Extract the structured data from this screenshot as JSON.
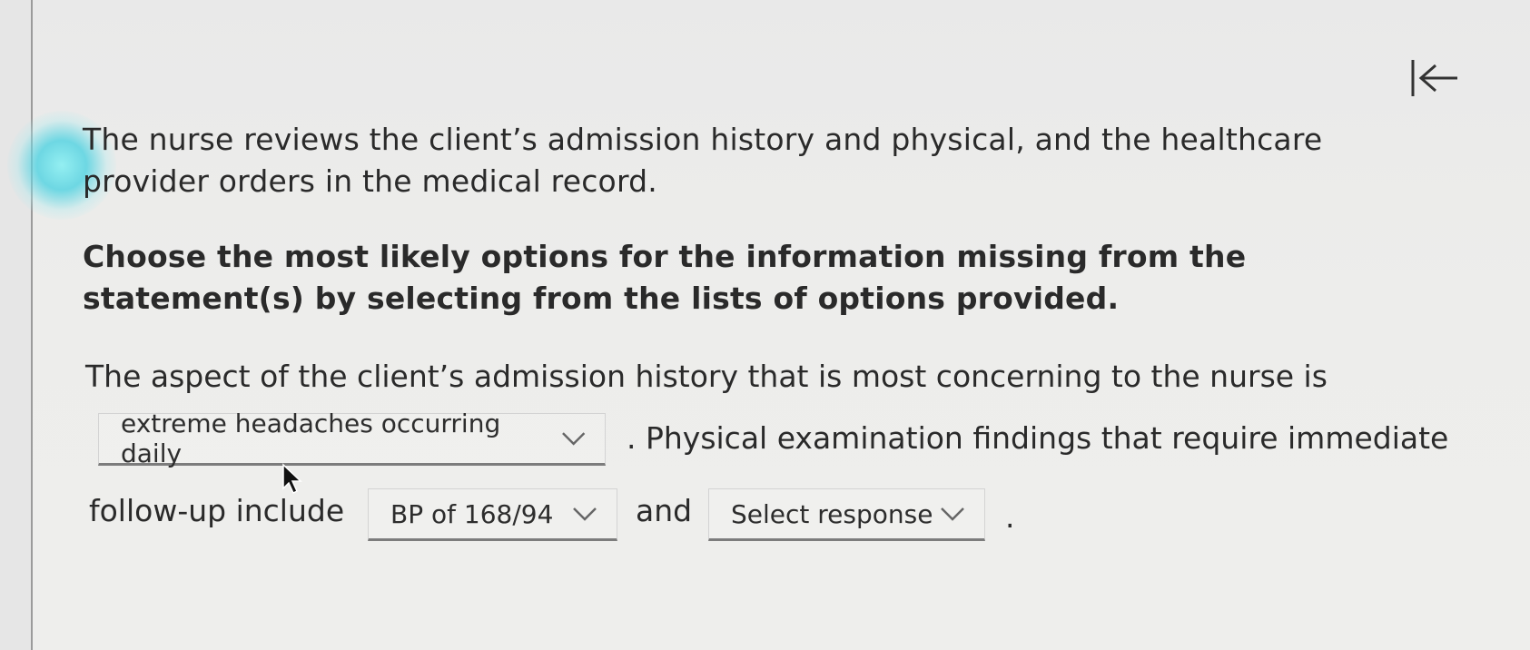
{
  "question": {
    "intro": "The nurse reviews the client’s admission history and physical, and the healthcare provider orders in the medical record.",
    "instruction": "Choose the most likely options for the information missing from the statement(s) by selecting from the lists of options provided.",
    "statement_start": "The aspect of the client’s admission history that is most concerning to the nurse is",
    "statement_middle": ". Physical examination findings that require immediate",
    "statement_followup": "follow-up include",
    "statement_and": "and",
    "statement_end": "."
  },
  "dropdowns": {
    "history_concern": "extreme headaches occurring daily",
    "physical_finding_1": "BP of 168/94",
    "physical_finding_2": "Select response"
  },
  "icons": {
    "collapse": "collapse-left-icon",
    "dropdown": "chevron-down-icon",
    "cursor": "mouse-pointer-icon"
  },
  "colors": {
    "background": "#ecece9",
    "text": "#2a2a2a",
    "dropdown_border": "#7c7c7c",
    "glare": "#54d6e4"
  }
}
